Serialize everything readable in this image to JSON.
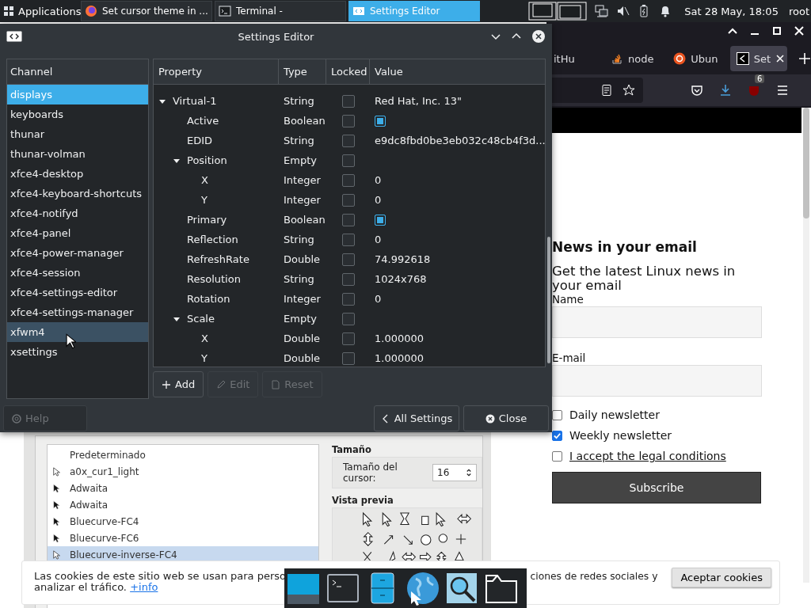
{
  "panel": {
    "apps_label": "Applications",
    "tasks": [
      {
        "label": "Set cursor theme in ...",
        "selected": false
      },
      {
        "label": "Terminal -",
        "selected": false
      },
      {
        "label": "Settings Editor",
        "selected": true
      }
    ],
    "clock": "Sat 28 May, 18:05",
    "user": "root"
  },
  "browser": {
    "tabs": [
      {
        "label": "itHu",
        "selected": false
      },
      {
        "label": "node",
        "selected": false
      },
      {
        "label": "Ubun",
        "selected": false
      },
      {
        "label": "Set",
        "selected": true
      }
    ],
    "extension_badge": "6",
    "newsletter": {
      "heading": "News in your email",
      "intro": "Get the latest Linux news in your email",
      "name_label": "Name",
      "email_label": "E-mail",
      "options": [
        {
          "label": "Daily newsletter",
          "checked": false,
          "kind": "plain"
        },
        {
          "label": "Weekly newsletter",
          "checked": true,
          "kind": "plain"
        },
        {
          "label": "I accept the legal conditions",
          "checked": false,
          "kind": "link"
        }
      ],
      "subscribe": "Subscribe"
    }
  },
  "cursor_dialog": {
    "themes": [
      {
        "name": "Predeterminado",
        "kind": "blank",
        "selected": false
      },
      {
        "name": "a0x_cur1_light",
        "kind": "light",
        "selected": false
      },
      {
        "name": "Adwaita",
        "kind": "dark",
        "selected": false
      },
      {
        "name": "Adwaita",
        "kind": "dark",
        "selected": false
      },
      {
        "name": "Bluecurve-FC4",
        "kind": "dark",
        "selected": false
      },
      {
        "name": "Bluecurve-FC6",
        "kind": "dark",
        "selected": false
      },
      {
        "name": "Bluecurve-inverse-FC4",
        "kind": "light",
        "selected": true
      }
    ],
    "size_heading": "Tamaño",
    "size_label": "Tamaño del cursor:",
    "size_value": "16",
    "preview_heading": "Vista previa"
  },
  "settings_editor": {
    "title": "Settings Editor",
    "channel_header": "Channel",
    "channels": [
      {
        "name": "displays",
        "selected": true,
        "hovered": false
      },
      {
        "name": "keyboards",
        "selected": false,
        "hovered": false
      },
      {
        "name": "thunar",
        "selected": false,
        "hovered": false
      },
      {
        "name": "thunar-volman",
        "selected": false,
        "hovered": false
      },
      {
        "name": "xfce4-desktop",
        "selected": false,
        "hovered": false
      },
      {
        "name": "xfce4-keyboard-shortcuts",
        "selected": false,
        "hovered": false
      },
      {
        "name": "xfce4-notifyd",
        "selected": false,
        "hovered": false
      },
      {
        "name": "xfce4-panel",
        "selected": false,
        "hovered": false
      },
      {
        "name": "xfce4-power-manager",
        "selected": false,
        "hovered": false
      },
      {
        "name": "xfce4-session",
        "selected": false,
        "hovered": false
      },
      {
        "name": "xfce4-settings-editor",
        "selected": false,
        "hovered": false
      },
      {
        "name": "xfce4-settings-manager",
        "selected": false,
        "hovered": false
      },
      {
        "name": "xfwm4",
        "selected": false,
        "hovered": true
      },
      {
        "name": "xsettings",
        "selected": false,
        "hovered": false
      }
    ],
    "columns": [
      "Property",
      "Type",
      "Locked",
      "Value"
    ],
    "rows": [
      {
        "property": "Virtual-1",
        "type": "String",
        "locked": false,
        "kind": "text",
        "value": "Red Hat, Inc. 13\"",
        "expanded": true,
        "children": [
          {
            "property": "Active",
            "type": "Boolean",
            "locked": false,
            "kind": "boolean",
            "checked": true
          },
          {
            "property": "EDID",
            "type": "String",
            "locked": false,
            "kind": "text",
            "value": "e9dc8fbd0be3eb032c48cb4f3d..."
          },
          {
            "property": "Position",
            "type": "Empty",
            "locked": false,
            "kind": "empty",
            "expanded": true,
            "children": [
              {
                "property": "X",
                "type": "Integer",
                "locked": false,
                "kind": "text",
                "value": "0"
              },
              {
                "property": "Y",
                "type": "Integer",
                "locked": false,
                "kind": "text",
                "value": "0"
              }
            ]
          },
          {
            "property": "Primary",
            "type": "Boolean",
            "locked": false,
            "kind": "boolean",
            "checked": true
          },
          {
            "property": "Reflection",
            "type": "String",
            "locked": false,
            "kind": "text",
            "value": "0"
          },
          {
            "property": "RefreshRate",
            "type": "Double",
            "locked": false,
            "kind": "text",
            "value": "74.992618"
          },
          {
            "property": "Resolution",
            "type": "String",
            "locked": false,
            "kind": "text",
            "value": "1024x768"
          },
          {
            "property": "Rotation",
            "type": "Integer",
            "locked": false,
            "kind": "text",
            "value": "0"
          },
          {
            "property": "Scale",
            "type": "Empty",
            "locked": false,
            "kind": "empty",
            "expanded": true,
            "children": [
              {
                "property": "X",
                "type": "Double",
                "locked": false,
                "kind": "text",
                "value": "1.000000"
              },
              {
                "property": "Y",
                "type": "Double",
                "locked": false,
                "kind": "text",
                "value": "1.000000"
              }
            ]
          }
        ]
      }
    ],
    "actions": [
      {
        "label": "Add",
        "disabled": false
      },
      {
        "label": "Edit",
        "disabled": true
      },
      {
        "label": "Reset",
        "disabled": true
      }
    ],
    "help": {
      "label": "Help",
      "disabled": true
    },
    "all_settings": "All Settings",
    "close": "Close"
  },
  "cookie_bar": {
    "text_start": "Las cookies de este sitio web se usan para perso",
    "text_line2": "analizar el tráfico.",
    "link": "+info",
    "text_end": "ciones de redes sociales y",
    "accept": "Aceptar cookies"
  }
}
